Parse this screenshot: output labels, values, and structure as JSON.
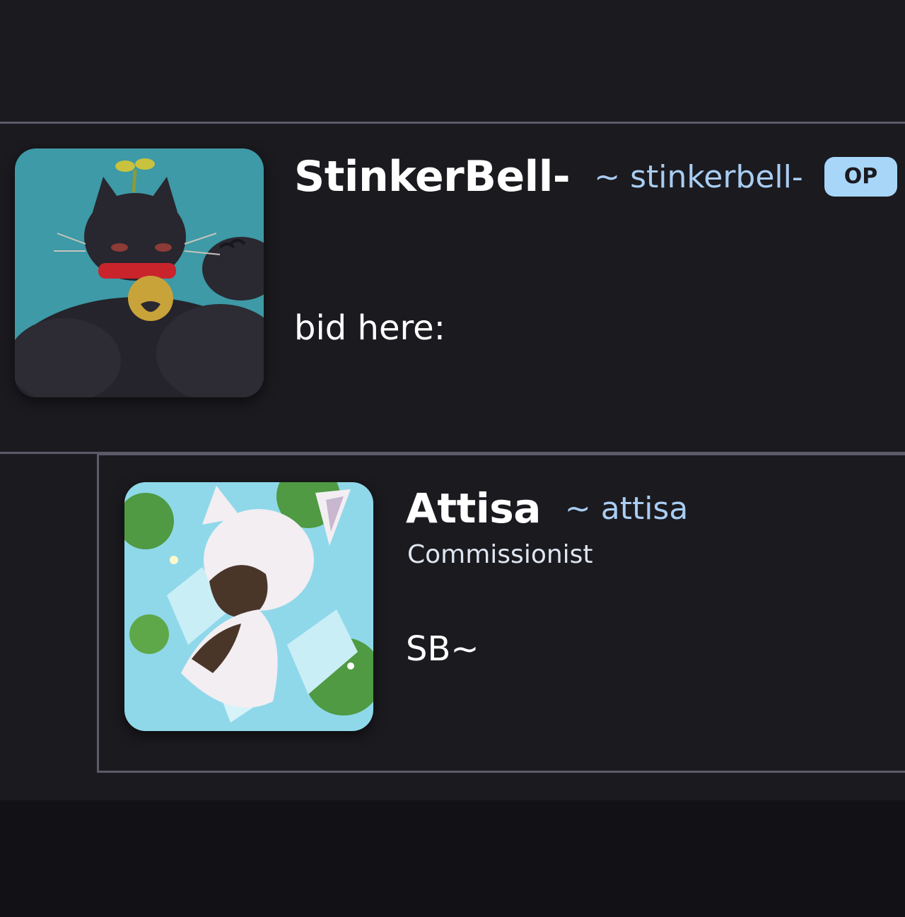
{
  "comments": [
    {
      "display_name": "StinkerBell-",
      "username": "~ stinkerbell-",
      "badge": "OP",
      "text": "bid here:"
    }
  ],
  "reply": {
    "display_name": "Attisa",
    "username": "~ attisa",
    "role": "Commissionist",
    "text": "SB~"
  },
  "icons": {
    "op_avatar": "black-cat-with-bell-avatar",
    "reply_avatar": "white-cat-lily-pad-avatar"
  },
  "colors": {
    "background": "#1b1a1f",
    "divider": "#5d5b69",
    "username": "#a9cdf2",
    "op_badge": "#a8d6f8"
  }
}
